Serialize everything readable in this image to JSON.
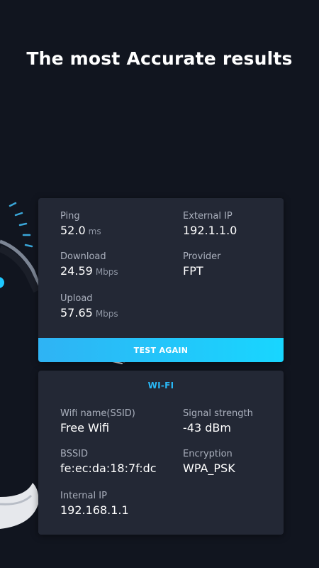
{
  "headline": "The most Accurate results",
  "results": {
    "ping": {
      "label": "Ping",
      "value": "52.0",
      "unit": "ms"
    },
    "download": {
      "label": "Download",
      "value": "24.59",
      "unit": "Mbps"
    },
    "upload": {
      "label": "Upload",
      "value": "57.65",
      "unit": "Mbps"
    },
    "external_ip": {
      "label": "External IP",
      "value": "192.1.1.0"
    },
    "provider": {
      "label": "Provider",
      "value": "FPT"
    },
    "button_label": "TEST AGAIN"
  },
  "wifi": {
    "title": "WI-FI",
    "ssid": {
      "label": "Wifi name(SSID)",
      "value": "Free Wifi"
    },
    "signal": {
      "label": "Signal strength",
      "value": "-43 dBm"
    },
    "bssid": {
      "label": "BSSID",
      "value": "fe:ec:da:18:7f:dc"
    },
    "encryption": {
      "label": "Encryption",
      "value": "WPA_PSK"
    },
    "internal_ip": {
      "label": "Internal IP",
      "value": "192.168.1.1"
    }
  },
  "colors": {
    "background": "#11151f",
    "card": "#232835",
    "accent": "#29b8f6"
  },
  "icons": {
    "phone_illustration": "phone-speedometer-illustration"
  }
}
